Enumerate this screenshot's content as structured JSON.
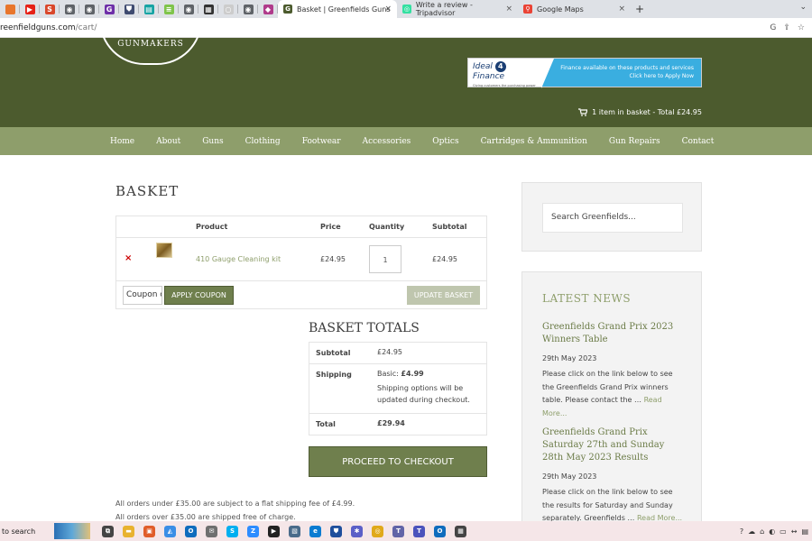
{
  "browser": {
    "pinned_tabs": [
      {
        "icon": "bookmark-icon",
        "color": "#e8762d",
        "glyph": ""
      },
      {
        "icon": "youtube-icon",
        "color": "#e62117",
        "glyph": "▶"
      },
      {
        "icon": "s-app-icon",
        "color": "#d9472b",
        "glyph": "S"
      },
      {
        "icon": "globe-icon",
        "color": "#5f6368",
        "glyph": "◉"
      },
      {
        "icon": "globe-icon",
        "color": "#5f6368",
        "glyph": "◉"
      },
      {
        "icon": "g-app-icon",
        "color": "#6e2fa8",
        "glyph": "G"
      },
      {
        "icon": "shield-icon",
        "color": "#3f4b70",
        "glyph": "⛊"
      },
      {
        "icon": "teal-app-icon",
        "color": "#16a3a3",
        "glyph": "▤"
      },
      {
        "icon": "green-app-icon",
        "color": "#7fc44a",
        "glyph": "≡"
      },
      {
        "icon": "globe-icon",
        "color": "#5f6368",
        "glyph": "◉"
      },
      {
        "icon": "grid-app-icon",
        "color": "#333333",
        "glyph": "▦"
      },
      {
        "icon": "circle-app-icon",
        "color": "#cccccc",
        "glyph": "○"
      },
      {
        "icon": "globe-icon",
        "color": "#5f6368",
        "glyph": "◉"
      },
      {
        "icon": "diamond-app-icon",
        "color": "#b03b8b",
        "glyph": "◆"
      }
    ],
    "tabs": [
      {
        "title": "Basket | Greenfields Guns",
        "icon": "greenfields-favicon",
        "color": "#4c5b2e",
        "glyph": "G",
        "active": true
      },
      {
        "title": "Write a review - Tripadvisor",
        "icon": "tripadvisor-favicon",
        "color": "#34e0a1",
        "glyph": "◎",
        "active": false
      },
      {
        "title": "Google Maps",
        "icon": "google-maps-favicon",
        "color": "#ea4335",
        "glyph": "⚲",
        "active": false
      }
    ],
    "newtab": "+",
    "address": {
      "host": "reenfieldguns.com",
      "path": "/cart/"
    }
  },
  "header": {
    "logo_text": "GUNMAKERS",
    "banner": {
      "brand_prefix": "Ideal",
      "brand_num": "4",
      "brand_suffix": "Finance",
      "tagline": "Giving customers the purchasing power",
      "line1": "Finance available on these products and services",
      "line2": "Click here to Apply Now"
    },
    "cart_summary": "1 item in basket - Total £24.95"
  },
  "nav": [
    "Home",
    "About",
    "Guns",
    "Clothing",
    "Footwear",
    "Accessories",
    "Optics",
    "Cartridges & Ammunition",
    "Gun Repairs",
    "Contact"
  ],
  "basket": {
    "heading": "BASKET",
    "columns": {
      "product": "Product",
      "price": "Price",
      "quantity": "Quantity",
      "subtotal": "Subtotal"
    },
    "items": [
      {
        "remove": "×",
        "name": "410 Gauge Cleaning kit",
        "price": "£24.95",
        "quantity": "1",
        "subtotal": "£24.95"
      }
    ],
    "coupon_placeholder": "Coupon code",
    "apply_coupon": "APPLY COUPON",
    "update_basket": "UPDATE BASKET"
  },
  "totals": {
    "heading": "BASKET TOTALS",
    "subtotal_label": "Subtotal",
    "subtotal_value": "£24.95",
    "shipping_label": "Shipping",
    "shipping_method": "Basic:",
    "shipping_cost": "£4.99",
    "shipping_note": "Shipping options will be updated during checkout.",
    "total_label": "Total",
    "total_value": "£29.94",
    "checkout": "PROCEED TO CHECKOUT"
  },
  "notes": [
    "All orders under £35.00 are subject to a flat shipping fee of £4.99.",
    "All orders over £35.00 are shipped free of charge."
  ],
  "sidebar": {
    "search_placeholder": "Search Greenfields...",
    "news_title": "LATEST NEWS",
    "posts": [
      {
        "title": "Greenfields Grand Prix 2023 Winners Table",
        "date": "29th May 2023",
        "excerpt": "Please click on the link below to see the Greenfields Grand Prix winners table. Please contact the …",
        "more": "Read More..."
      },
      {
        "title": "Greenfields Grand Prix Saturday 27th and Sunday 28th May 2023 Results",
        "date": "29th May 2023",
        "excerpt": "Please click on the link below to see the results for Saturday and Sunday separately. Greenfields …",
        "more": "Read More..."
      }
    ]
  },
  "taskbar": {
    "search_text": "to search",
    "apps": [
      {
        "icon": "task-view-icon",
        "color": "#444444",
        "glyph": "⧉"
      },
      {
        "icon": "file-explorer-icon",
        "color": "#e8b22f",
        "glyph": "▬"
      },
      {
        "icon": "store-icon",
        "color": "#e05d2a",
        "glyph": "▣"
      },
      {
        "icon": "photos-icon",
        "color": "#3a8ee6",
        "glyph": "◭"
      },
      {
        "icon": "outlook-icon",
        "color": "#0f6cbd",
        "glyph": "O"
      },
      {
        "icon": "mail-icon",
        "color": "#6f6f6f",
        "glyph": "✉"
      },
      {
        "icon": "skype-icon",
        "color": "#00aff0",
        "glyph": "S"
      },
      {
        "icon": "zoom-icon",
        "color": "#2d8cff",
        "glyph": "Z"
      },
      {
        "icon": "media-player-icon",
        "color": "#222222",
        "glyph": "▶"
      },
      {
        "icon": "scanner-icon",
        "color": "#4a6b8a",
        "glyph": "▧"
      },
      {
        "icon": "edge-icon",
        "color": "#0c7bd1",
        "glyph": "e"
      },
      {
        "icon": "shield-app-icon",
        "color": "#1f4e9c",
        "glyph": "⛊"
      },
      {
        "icon": "settings-app-icon",
        "color": "#5b5fc7",
        "glyph": "✱"
      },
      {
        "icon": "chrome-icon",
        "color": "#e0a91a",
        "glyph": "◎"
      },
      {
        "icon": "teams-icon",
        "color": "#6264a7",
        "glyph": "T"
      },
      {
        "icon": "teams-icon-2",
        "color": "#4b53bc",
        "glyph": "T"
      },
      {
        "icon": "outlook-icon-2",
        "color": "#0f6cbd",
        "glyph": "O"
      },
      {
        "icon": "calculator-icon",
        "color": "#444444",
        "glyph": "▦"
      }
    ],
    "tray": [
      "?",
      "☁",
      "⌂",
      "◐",
      "▭",
      "↔",
      "▤"
    ]
  }
}
